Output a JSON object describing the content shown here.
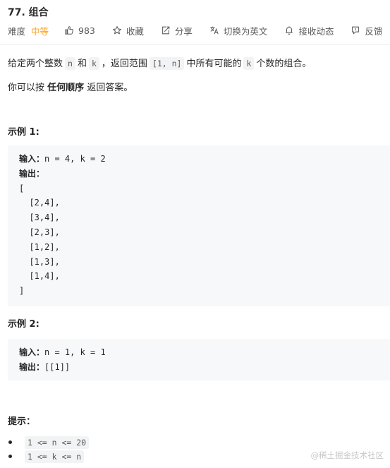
{
  "problem": {
    "title": "77. 组合",
    "difficulty_label": "难度",
    "difficulty": "中等",
    "likes": "983",
    "favorite": "收藏",
    "share": "分享",
    "switch_lang": "切换为英文",
    "subscribe": "接收动态",
    "feedback": "反馈"
  },
  "description": {
    "p1_a": "给定两个整数",
    "p1_n": "n",
    "p1_and": "和",
    "p1_k": "k",
    "p1_b": "，返回范围",
    "p1_range": "[1, n]",
    "p1_c": "中所有可能的",
    "p1_k2": "k",
    "p1_d": "个数的组合。",
    "p2_a": "你可以按",
    "p2_bold": "任何顺序",
    "p2_b": "返回答案。"
  },
  "example1": {
    "title": "示例 1:",
    "input_label": "输入：",
    "input": "n = 4, k = 2",
    "output_label": "输出：",
    "output_lines": [
      "[",
      "  [2,4],",
      "  [3,4],",
      "  [2,3],",
      "  [1,2],",
      "  [1,3],",
      "  [1,4],",
      "]"
    ]
  },
  "example2": {
    "title": "示例 2:",
    "input_label": "输入：",
    "input": "n = 1, k = 1",
    "output_label": "输出：",
    "output": "[[1]]"
  },
  "hints": {
    "title": "提示：",
    "items": [
      "1 <= n <= 20",
      "1 <= k <= n"
    ]
  },
  "watermark": "@稀土掘金技术社区",
  "colors": {
    "difficulty": "#ffa116",
    "code_bg": "#f7f8fa",
    "text": "#262626"
  }
}
